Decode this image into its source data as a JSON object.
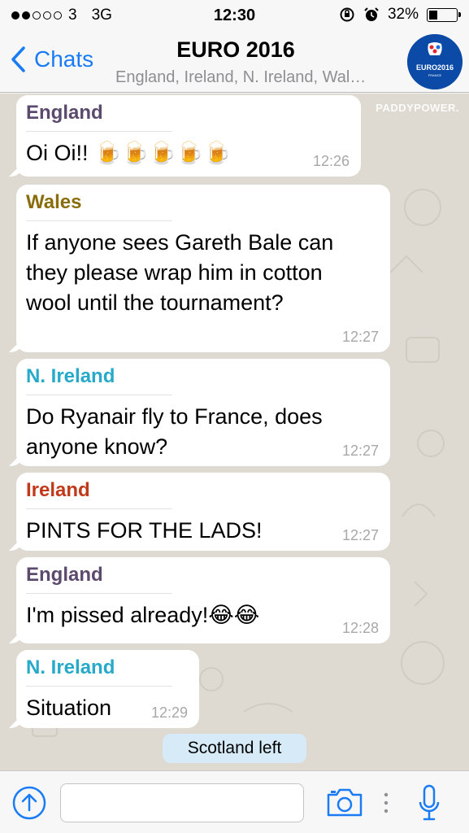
{
  "status_bar": {
    "carrier": "3",
    "network": "3G",
    "time": "12:30",
    "battery": "32%",
    "battery_level": 0.32,
    "signal_bars_filled": 2,
    "signal_bars_total": 5
  },
  "nav": {
    "back_label": "Chats",
    "title": "EURO 2016",
    "subtitle": "England, Ireland, N. Ireland, Wal…",
    "avatar_text": "EURO2016",
    "avatar_subtext": "FRANCE"
  },
  "watermark": "PADDYPOWER.",
  "messages": [
    {
      "sender": "England",
      "sender_color": "#5b4a6e",
      "text": "Oi Oi!! 🍺🍺🍺🍺🍺",
      "time": "12:26"
    },
    {
      "sender": "Wales",
      "sender_color": "#8a6d0b",
      "text": "If anyone sees Gareth Bale can they please wrap him in cotton wool until the tournament?",
      "time": "12:27"
    },
    {
      "sender": "N. Ireland",
      "sender_color": "#27a9c9",
      "text": "Do Ryanair fly to France, does anyone know?",
      "time": "12:27"
    },
    {
      "sender": "Ireland",
      "sender_color": "#c0391b",
      "text": "PINTS FOR THE LADS!",
      "time": "12:27"
    },
    {
      "sender": "England",
      "sender_color": "#5b4a6e",
      "text": "I'm pissed already!😂😂",
      "time": "12:28"
    },
    {
      "sender": "N. Ireland",
      "sender_color": "#27a9c9",
      "text": "Situation",
      "time": "12:29"
    }
  ],
  "system_message": "Scotland left",
  "input": {
    "value": "",
    "placeholder": ""
  },
  "colors": {
    "accent": "#1a7cf5",
    "chat_background": "#dedad2",
    "system_bubble": "#d6ebf7"
  }
}
